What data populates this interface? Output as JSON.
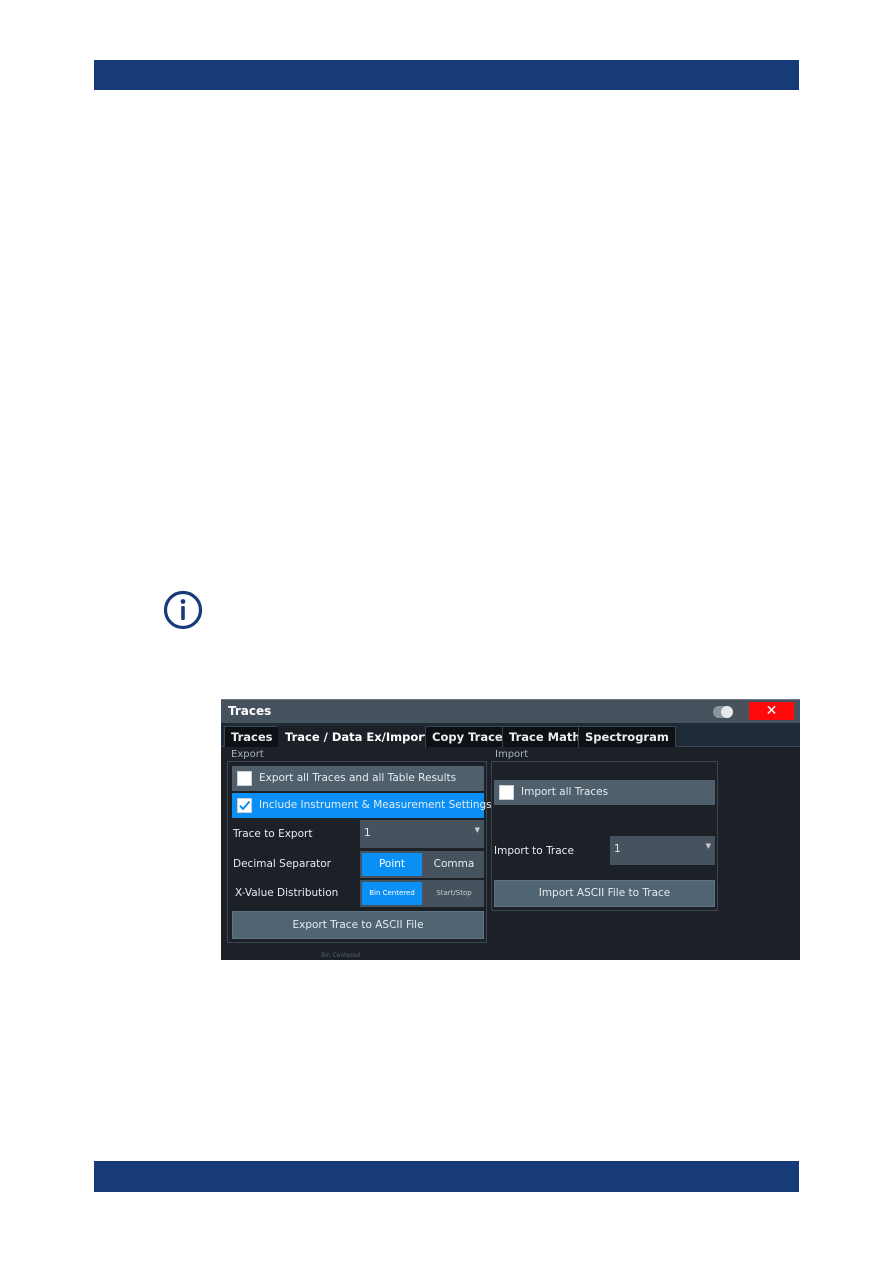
{
  "page": {
    "header_color": "#173a78",
    "footer_color": "#173a78"
  },
  "note": {
    "icon": "info-icon"
  },
  "dialog": {
    "title": "Traces",
    "toggle_icon": "toggle-switch-icon",
    "close_label": "✕",
    "tabs": [
      {
        "label": "Traces",
        "active": false
      },
      {
        "label": "Trace / Data Ex/Import",
        "active": true
      },
      {
        "label": "Copy Trace",
        "active": false
      },
      {
        "label": "Trace Math",
        "active": false
      },
      {
        "label": "Spectrogram",
        "active": false
      }
    ],
    "export": {
      "group_label": "Export",
      "export_all": {
        "label": "Export all Traces and all Table Results",
        "checked": false
      },
      "include_settings": {
        "label": "Include Instrument & Measurement Settings",
        "checked": true
      },
      "trace_to_export": {
        "label": "Trace to Export",
        "value": "1"
      },
      "decimal_separator": {
        "label": "Decimal Separator",
        "options": [
          "Point",
          "Comma"
        ],
        "selected": "Point"
      },
      "x_value_distribution": {
        "label": "X-Value Distribution",
        "options": [
          "Bin Centered",
          "Start/Stop"
        ],
        "selected": "Bin Centered"
      },
      "export_button": "Export Trace to ASCII File"
    },
    "import": {
      "group_label": "Import",
      "import_all": {
        "label": "Import all Traces",
        "checked": false
      },
      "import_to_trace": {
        "label": "Import to Trace",
        "value": "1"
      },
      "import_button": "Import ASCII File to Trace"
    },
    "faint_footer_text": "Bin Centered",
    "accent_color": "#0a8ff5",
    "close_color": "#ff0a0a"
  }
}
